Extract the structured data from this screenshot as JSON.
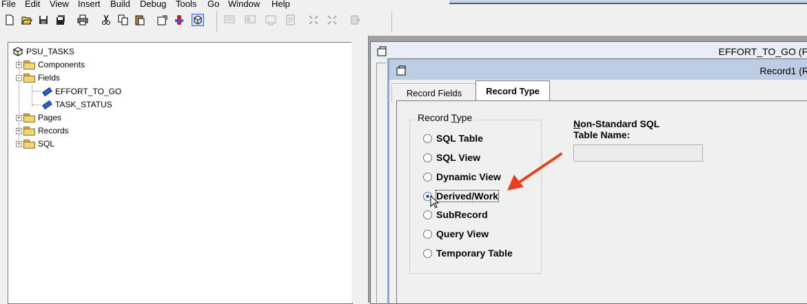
{
  "menu": {
    "items": [
      "File",
      "Edit",
      "View",
      "Insert",
      "Build",
      "Debug",
      "Tools",
      "Go",
      "Window",
      "Help"
    ]
  },
  "toolbar": {
    "icons": [
      "new-icon",
      "open-icon",
      "save-icon",
      "save-all-icon",
      "print-icon",
      "cut-icon",
      "copy-icon",
      "paste-icon",
      "properties-icon",
      "build-icon",
      "project-icon",
      "view-definition-icon",
      "view-layout-icon",
      "view-sql-icon",
      "view-peoplecode-icon",
      "zoom-in-icon",
      "zoom-out-icon",
      "compare-icon"
    ]
  },
  "tree": {
    "root": "PSU_TASKS",
    "nodes": [
      {
        "label": "Components",
        "expanded": false
      },
      {
        "label": "Fields",
        "expanded": true,
        "children": [
          "EFFORT_TO_GO",
          "TASK_STATUS"
        ]
      },
      {
        "label": "Pages",
        "expanded": false
      },
      {
        "label": "Records",
        "expanded": false
      },
      {
        "label": "SQL",
        "expanded": false
      }
    ]
  },
  "windows": {
    "back_title": "EFFORT_TO_GO (F",
    "front_title": "Record1 (R"
  },
  "tabs": [
    {
      "label": "Record Fields",
      "active": false
    },
    {
      "label": "Record Type",
      "active": true
    }
  ],
  "record_type": {
    "group_title": "Record Type",
    "options": [
      "SQL Table",
      "SQL View",
      "Dynamic View",
      "Derived/Work",
      "SubRecord",
      "Query View",
      "Temporary Table"
    ],
    "selected": "Derived/Work"
  },
  "non_standard_sql": {
    "label_line1": "Non-Standard SQL",
    "label_line2": "Table Name:",
    "value": ""
  },
  "colors": {
    "annotation_arrow": "#e8401c",
    "window_titlebar": "#bdcde4"
  }
}
